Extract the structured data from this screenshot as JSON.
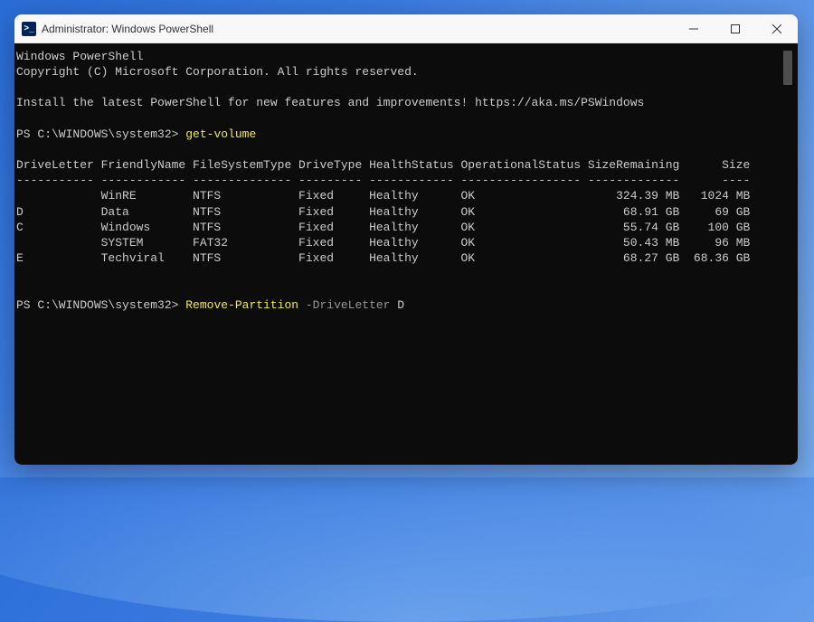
{
  "titlebar": {
    "icon_label": ">_",
    "title": "Administrator: Windows PowerShell"
  },
  "terminal": {
    "header1": "Windows PowerShell",
    "header2": "Copyright (C) Microsoft Corporation. All rights reserved.",
    "install_msg": "Install the latest PowerShell for new features and improvements! https://aka.ms/PSWindows",
    "prompt1_prefix": "PS C:\\WINDOWS\\system32> ",
    "cmd1": "get-volume",
    "columns": "DriveLetter FriendlyName FileSystemType DriveType HealthStatus OperationalStatus SizeRemaining      Size",
    "separator": "----------- ------------ -------------- --------- ------------ ----------------- -------------      ----",
    "rows": [
      "            WinRE        NTFS           Fixed     Healthy      OK                    324.39 MB   1024 MB",
      "D           Data         NTFS           Fixed     Healthy      OK                     68.91 GB     69 GB",
      "C           Windows      NTFS           Fixed     Healthy      OK                     55.74 GB    100 GB",
      "            SYSTEM       FAT32          Fixed     Healthy      OK                     50.43 MB     96 MB",
      "E           Techviral    NTFS           Fixed     Healthy      OK                     68.27 GB  68.36 GB"
    ],
    "prompt2_prefix": "PS C:\\WINDOWS\\system32> ",
    "cmd2_part1": "Remove-Partition ",
    "cmd2_part2": "-DriveLetter ",
    "cmd2_part3": "D"
  },
  "chart_data": {
    "type": "table",
    "title": "get-volume output",
    "columns": [
      "DriveLetter",
      "FriendlyName",
      "FileSystemType",
      "DriveType",
      "HealthStatus",
      "OperationalStatus",
      "SizeRemaining",
      "Size"
    ],
    "rows": [
      [
        "",
        "WinRE",
        "NTFS",
        "Fixed",
        "Healthy",
        "OK",
        "324.39 MB",
        "1024 MB"
      ],
      [
        "D",
        "Data",
        "NTFS",
        "Fixed",
        "Healthy",
        "OK",
        "68.91 GB",
        "69 GB"
      ],
      [
        "C",
        "Windows",
        "NTFS",
        "Fixed",
        "Healthy",
        "OK",
        "55.74 GB",
        "100 GB"
      ],
      [
        "",
        "SYSTEM",
        "FAT32",
        "Fixed",
        "Healthy",
        "OK",
        "50.43 MB",
        "96 MB"
      ],
      [
        "E",
        "Techviral",
        "NTFS",
        "Fixed",
        "Healthy",
        "OK",
        "68.27 GB",
        "68.36 GB"
      ]
    ]
  }
}
